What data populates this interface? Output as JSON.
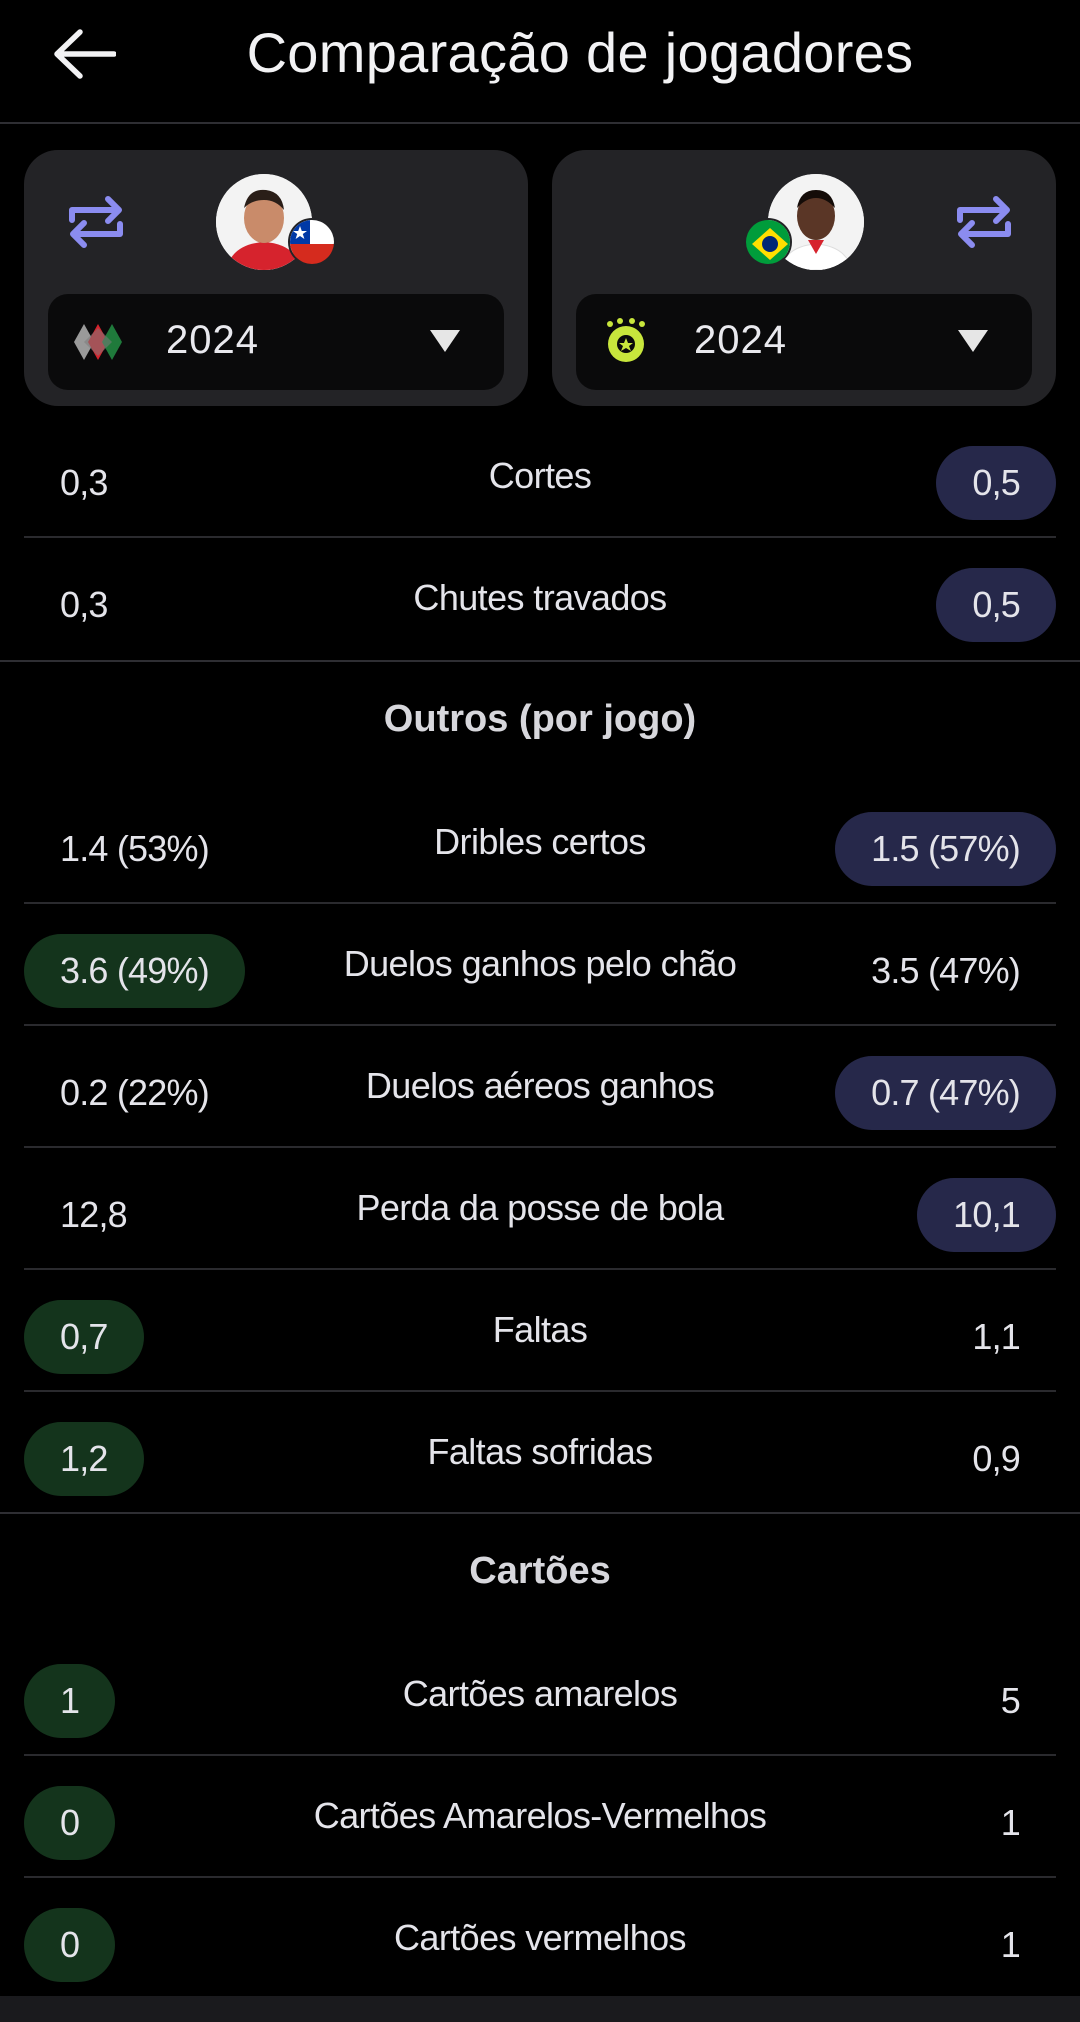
{
  "header": {
    "title": "Comparação de jogadores",
    "back_icon": "arrow-left-icon"
  },
  "players": [
    {
      "side": "left",
      "season_year": "2024",
      "league_logo": "liga-mx-logo",
      "flag": "chile-flag",
      "swap_icon": "swap-icon",
      "accent": "#8b8cf0"
    },
    {
      "side": "right",
      "season_year": "2024",
      "league_logo": "brasileirao-logo",
      "flag": "brazil-flag",
      "swap_icon": "swap-icon",
      "accent": "#8b8cf0"
    }
  ],
  "defense_rows": [
    {
      "label": "Cortes",
      "left": "0,3",
      "right": "0,5",
      "highlight": "right"
    },
    {
      "label": "Chutes travados",
      "left": "0,3",
      "right": "0,5",
      "highlight": "right"
    }
  ],
  "others": {
    "title": "Outros (por jogo)",
    "rows": [
      {
        "label": "Dribles certos",
        "left": "1.4 (53%)",
        "right": "1.5 (57%)",
        "highlight": "right"
      },
      {
        "label": "Duelos ganhos pelo chão",
        "left": "3.6 (49%)",
        "right": "3.5 (47%)",
        "highlight": "left"
      },
      {
        "label": "Duelos aéreos ganhos",
        "left": "0.2 (22%)",
        "right": "0.7 (47%)",
        "highlight": "right"
      },
      {
        "label": "Perda da posse de bola",
        "left": "12,8",
        "right": "10,1",
        "highlight": "right"
      },
      {
        "label": "Faltas",
        "left": "0,7",
        "right": "1,1",
        "highlight": "left"
      },
      {
        "label": "Faltas sofridas",
        "left": "1,2",
        "right": "0,9",
        "highlight": "left"
      }
    ]
  },
  "cards": {
    "title": "Cartões",
    "rows": [
      {
        "label": "Cartões amarelos",
        "left": "1",
        "right": "5",
        "highlight": "left"
      },
      {
        "label": "Cartões Amarelos-Vermelhos",
        "left": "0",
        "right": "1",
        "highlight": "left"
      },
      {
        "label": "Cartões vermelhos",
        "left": "0",
        "right": "1",
        "highlight": "left"
      }
    ]
  },
  "colors": {
    "highlight_right": "#26284a",
    "highlight_left": "#14341c",
    "background": "#000000",
    "card": "#232326"
  }
}
